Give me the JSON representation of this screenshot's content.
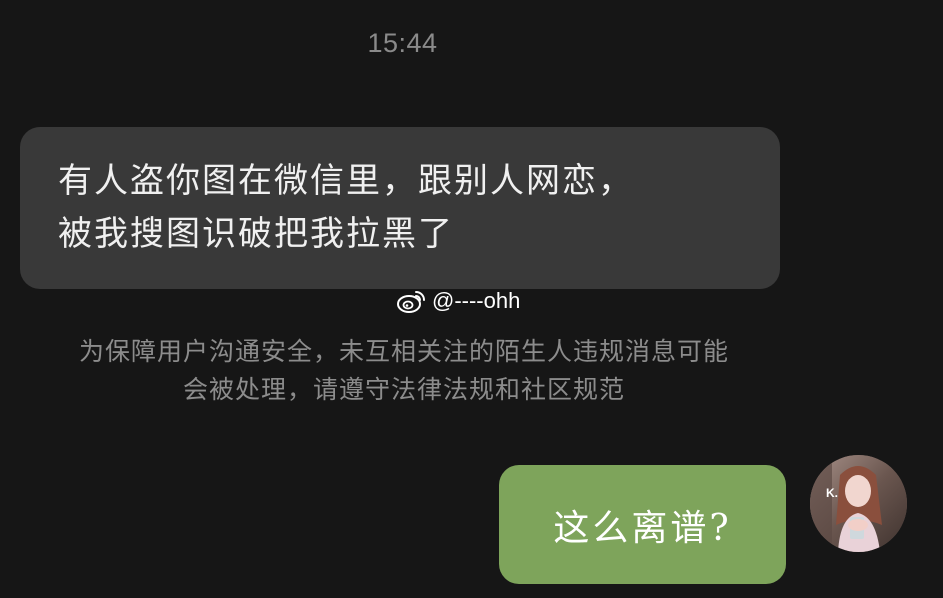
{
  "chat": {
    "timestamp": "15:44",
    "incoming_message": {
      "line1": "有人盗你图在微信里，跟别人网恋，",
      "line2": "被我搜图识破把我拉黑了"
    },
    "watermark": {
      "handle": "@----ohh",
      "icon": "weibo-icon"
    },
    "system_notice": {
      "line1": "为保障用户沟通安全，未互相关注的陌生人违规消息可能",
      "line2": "会被处理，请遵守法律法规和社区规范"
    },
    "outgoing_message": {
      "text": "这么离谱?"
    },
    "avatar": {
      "overlay_text": "K."
    }
  },
  "colors": {
    "background": "#161616",
    "incoming_bubble": "#393939",
    "outgoing_bubble": "#7ea45b",
    "muted_text": "#8a8a8a"
  }
}
